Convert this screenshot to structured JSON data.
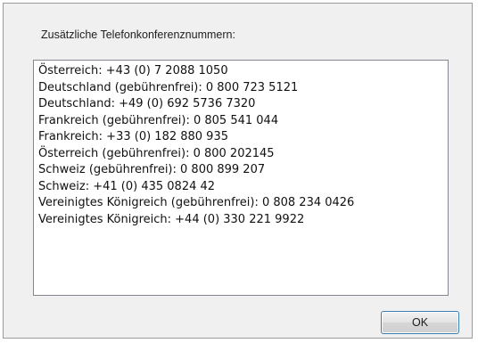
{
  "dialog": {
    "heading": "Zusätzliche Telefonkonferenznummern:",
    "numbers": [
      "Österreich: +43 (0) 7 2088 1050",
      "Deutschland (gebührenfrei): 0 800 723 5121",
      "Deutschland: +49 (0) 692 5736 7320",
      "Frankreich (gebührenfrei): 0 805 541 044",
      "Frankreich: +33 (0) 182 880 935",
      "Österreich (gebührenfrei): 0 800 202145",
      "Schweiz (gebührenfrei): 0 800 899 207",
      "Schweiz: +41 (0) 435 0824 42",
      "Vereinigtes Königreich (gebührenfrei): 0 808 234 0426",
      "Vereinigtes Königreich: +44 (0) 330 221 9922"
    ],
    "ok_label": "OK"
  }
}
